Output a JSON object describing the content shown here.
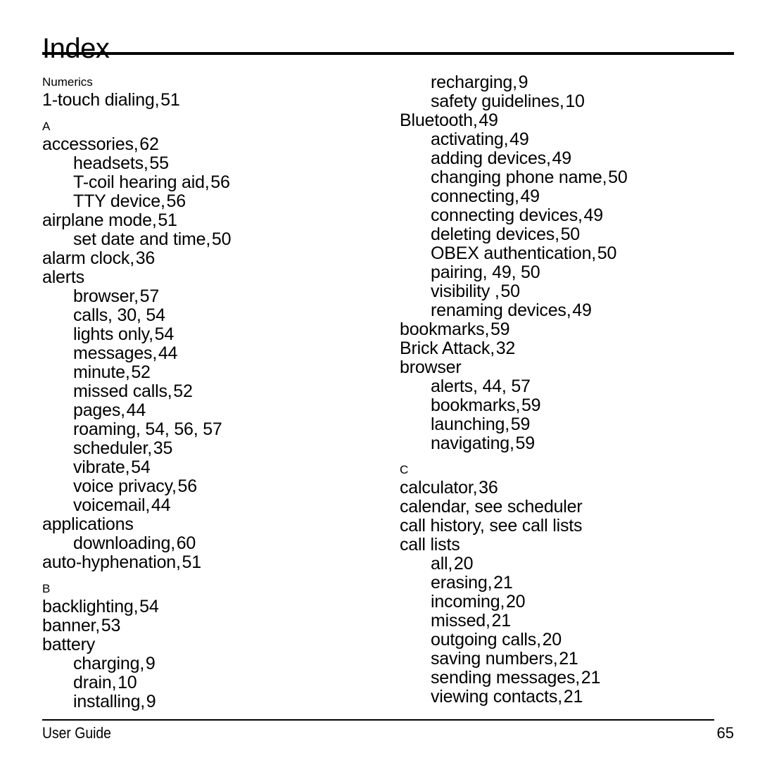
{
  "document": {
    "title": "Index",
    "footer": {
      "left_label": "User Guide",
      "page_number": "65"
    }
  },
  "columns": [
    {
      "id": "left-column",
      "blocks": [
        {
          "section_letter": "Numerics",
          "entries": [
            {
              "level": 1,
              "term": "1-touch dialing",
              "pages": "51"
            }
          ]
        },
        {
          "section_letter": "A",
          "entries": [
            {
              "level": 1,
              "term": "accessories",
              "pages": "62"
            },
            {
              "level": 2,
              "term": "headsets",
              "pages": "55"
            },
            {
              "level": 2,
              "term": "T-coil hearing aid",
              "pages": "56"
            },
            {
              "level": 2,
              "term": "TTY device",
              "pages": "56"
            },
            {
              "level": 1,
              "term": "airplane mode",
              "pages": "51"
            },
            {
              "level": 2,
              "term": "set date and time",
              "pages": "50"
            },
            {
              "level": 1,
              "term": "alarm clock",
              "pages": "36"
            },
            {
              "level": 1,
              "term": "alerts",
              "pages": ""
            },
            {
              "level": 2,
              "term": "browser",
              "pages": "57"
            },
            {
              "level": 2,
              "term": "calls",
              "pages": "30, 54"
            },
            {
              "level": 2,
              "term": "lights only",
              "pages": "54"
            },
            {
              "level": 2,
              "term": "messages",
              "pages": "44"
            },
            {
              "level": 2,
              "term": "minute",
              "pages": "52"
            },
            {
              "level": 2,
              "term": "missed calls",
              "pages": "52"
            },
            {
              "level": 2,
              "term": "pages",
              "pages": "44"
            },
            {
              "level": 2,
              "term": "roaming",
              "pages": "54, 56, 57"
            },
            {
              "level": 2,
              "term": "scheduler",
              "pages": "35"
            },
            {
              "level": 2,
              "term": "vibrate",
              "pages": "54"
            },
            {
              "level": 2,
              "term": "voice privacy",
              "pages": "56"
            },
            {
              "level": 2,
              "term": "voicemail",
              "pages": "44"
            },
            {
              "level": 1,
              "term": "applications",
              "pages": ""
            },
            {
              "level": 2,
              "term": "downloading",
              "pages": "60"
            },
            {
              "level": 1,
              "term": "auto-hyphenation",
              "pages": "51"
            }
          ]
        },
        {
          "section_letter": "B",
          "entries": [
            {
              "level": 1,
              "term": "backlighting",
              "pages": "54"
            },
            {
              "level": 1,
              "term": "banner",
              "pages": "53"
            },
            {
              "level": 1,
              "term": "battery",
              "pages": ""
            },
            {
              "level": 2,
              "term": "charging",
              "pages": "9"
            },
            {
              "level": 2,
              "term": "drain",
              "pages": "10"
            },
            {
              "level": 2,
              "term": "installing",
              "pages": "9"
            }
          ]
        }
      ]
    },
    {
      "id": "right-column",
      "blocks": [
        {
          "section_letter": "",
          "entries": [
            {
              "level": 2,
              "term": "recharging",
              "pages": "9"
            },
            {
              "level": 2,
              "term": "safety guidelines",
              "pages": "10"
            },
            {
              "level": 1,
              "term": "Bluetooth",
              "pages": "49"
            },
            {
              "level": 2,
              "term": "activating",
              "pages": "49"
            },
            {
              "level": 2,
              "term": "adding devices",
              "pages": "49"
            },
            {
              "level": 2,
              "term": "changing phone name",
              "pages": "50"
            },
            {
              "level": 2,
              "term": "connecting",
              "pages": "49"
            },
            {
              "level": 2,
              "term": "connecting devices",
              "pages": "49"
            },
            {
              "level": 2,
              "term": "deleting devices",
              "pages": "50"
            },
            {
              "level": 2,
              "term": "OBEX authentication",
              "pages": "50"
            },
            {
              "level": 2,
              "term": "pairing",
              "pages": "49, 50"
            },
            {
              "level": 2,
              "term": "visibility ",
              "pages": "50"
            },
            {
              "level": 2,
              "term": "renaming devices",
              "pages": "49"
            },
            {
              "level": 1,
              "term": "bookmarks",
              "pages": "59"
            },
            {
              "level": 1,
              "term": "Brick Attack",
              "pages": "32"
            },
            {
              "level": 1,
              "term": "browser",
              "pages": ""
            },
            {
              "level": 2,
              "term": "alerts",
              "pages": "44, 57"
            },
            {
              "level": 2,
              "term": "bookmarks",
              "pages": "59"
            },
            {
              "level": 2,
              "term": "launching",
              "pages": "59"
            },
            {
              "level": 2,
              "term": "navigating",
              "pages": "59"
            }
          ]
        },
        {
          "section_letter": "C",
          "entries": [
            {
              "level": 1,
              "term": "calculator",
              "pages": "36"
            },
            {
              "level": 1,
              "term": "calendar, see scheduler",
              "pages": ""
            },
            {
              "level": 1,
              "term": "call history, see call lists",
              "pages": ""
            },
            {
              "level": 1,
              "term": "call lists",
              "pages": ""
            },
            {
              "level": 2,
              "term": "all",
              "pages": "20"
            },
            {
              "level": 2,
              "term": "erasing",
              "pages": "21"
            },
            {
              "level": 2,
              "term": "incoming",
              "pages": "20"
            },
            {
              "level": 2,
              "term": "missed",
              "pages": "21"
            },
            {
              "level": 2,
              "term": "outgoing calls",
              "pages": "20"
            },
            {
              "level": 2,
              "term": "saving numbers",
              "pages": "21"
            },
            {
              "level": 2,
              "term": "sending messages",
              "pages": "21"
            },
            {
              "level": 2,
              "term": "viewing contacts",
              "pages": "21"
            }
          ]
        }
      ]
    }
  ]
}
